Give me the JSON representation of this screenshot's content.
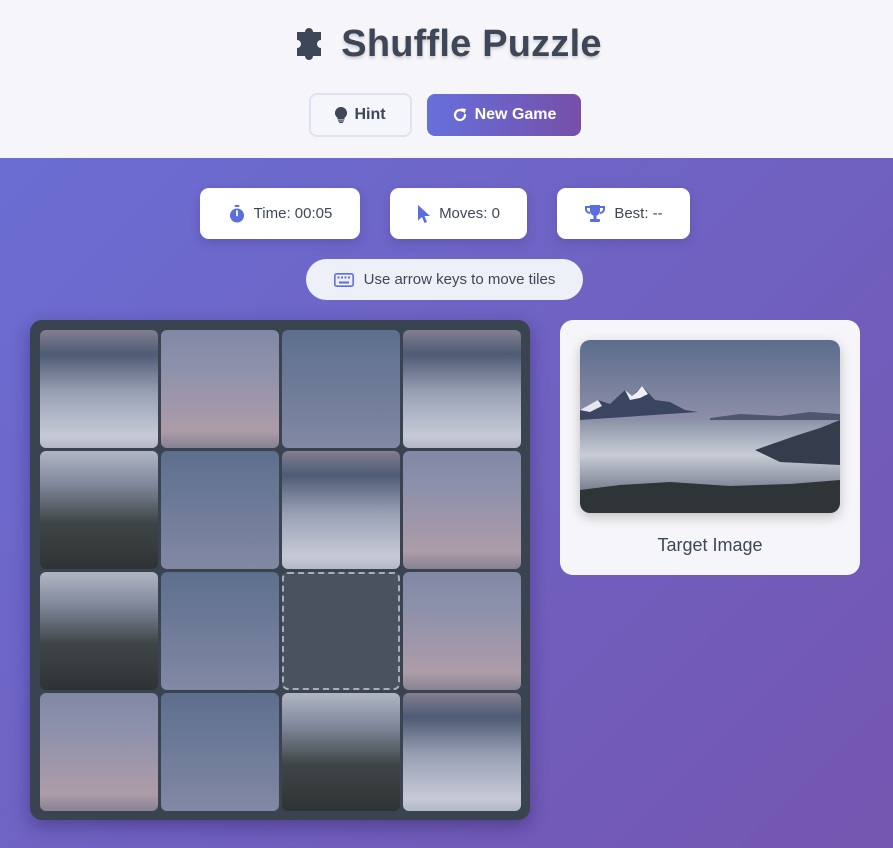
{
  "app": {
    "title": "Shuffle Puzzle",
    "title_icon": "puzzle-piece-icon"
  },
  "controls": {
    "hint_label": "Hint",
    "hint_icon": "lightbulb-icon",
    "new_game_label": "New Game",
    "new_game_icon": "redo-icon"
  },
  "stats": {
    "time_label": "Time: 00:05",
    "time_icon": "stopwatch-icon",
    "moves_label": "Moves: 0",
    "moves_icon": "pointer-icon",
    "best_label": "Best: --",
    "best_icon": "trophy-icon"
  },
  "instruction": {
    "text": "Use arrow keys to move tiles",
    "icon": "keyboard-icon"
  },
  "board": {
    "grid_size": 4,
    "empty_cell": {
      "row": 2,
      "col": 2
    },
    "tiles": [
      {
        "row": 0,
        "col": 0,
        "piece": 8
      },
      {
        "row": 0,
        "col": 1,
        "piece": 5
      },
      {
        "row": 0,
        "col": 2,
        "piece": 3
      },
      {
        "row": 0,
        "col": 3,
        "piece": 10
      },
      {
        "row": 1,
        "col": 0,
        "piece": 12
      },
      {
        "row": 1,
        "col": 1,
        "piece": 2
      },
      {
        "row": 1,
        "col": 2,
        "piece": 9
      },
      {
        "row": 1,
        "col": 3,
        "piece": 6
      },
      {
        "row": 2,
        "col": 0,
        "piece": 13
      },
      {
        "row": 2,
        "col": 1,
        "piece": 0
      },
      {
        "row": 2,
        "col": 3,
        "piece": 7
      },
      {
        "row": 3,
        "col": 0,
        "piece": 4
      },
      {
        "row": 3,
        "col": 1,
        "piece": 1
      },
      {
        "row": 3,
        "col": 2,
        "piece": 14
      },
      {
        "row": 3,
        "col": 3,
        "piece": 11
      }
    ]
  },
  "target": {
    "label": "Target Image"
  },
  "colors": {
    "accent_start": "#6670dc",
    "accent_end": "#764fa8",
    "text": "#3d4757",
    "board_bg": "#3a4350",
    "icon_blue": "#5a6ee0"
  }
}
